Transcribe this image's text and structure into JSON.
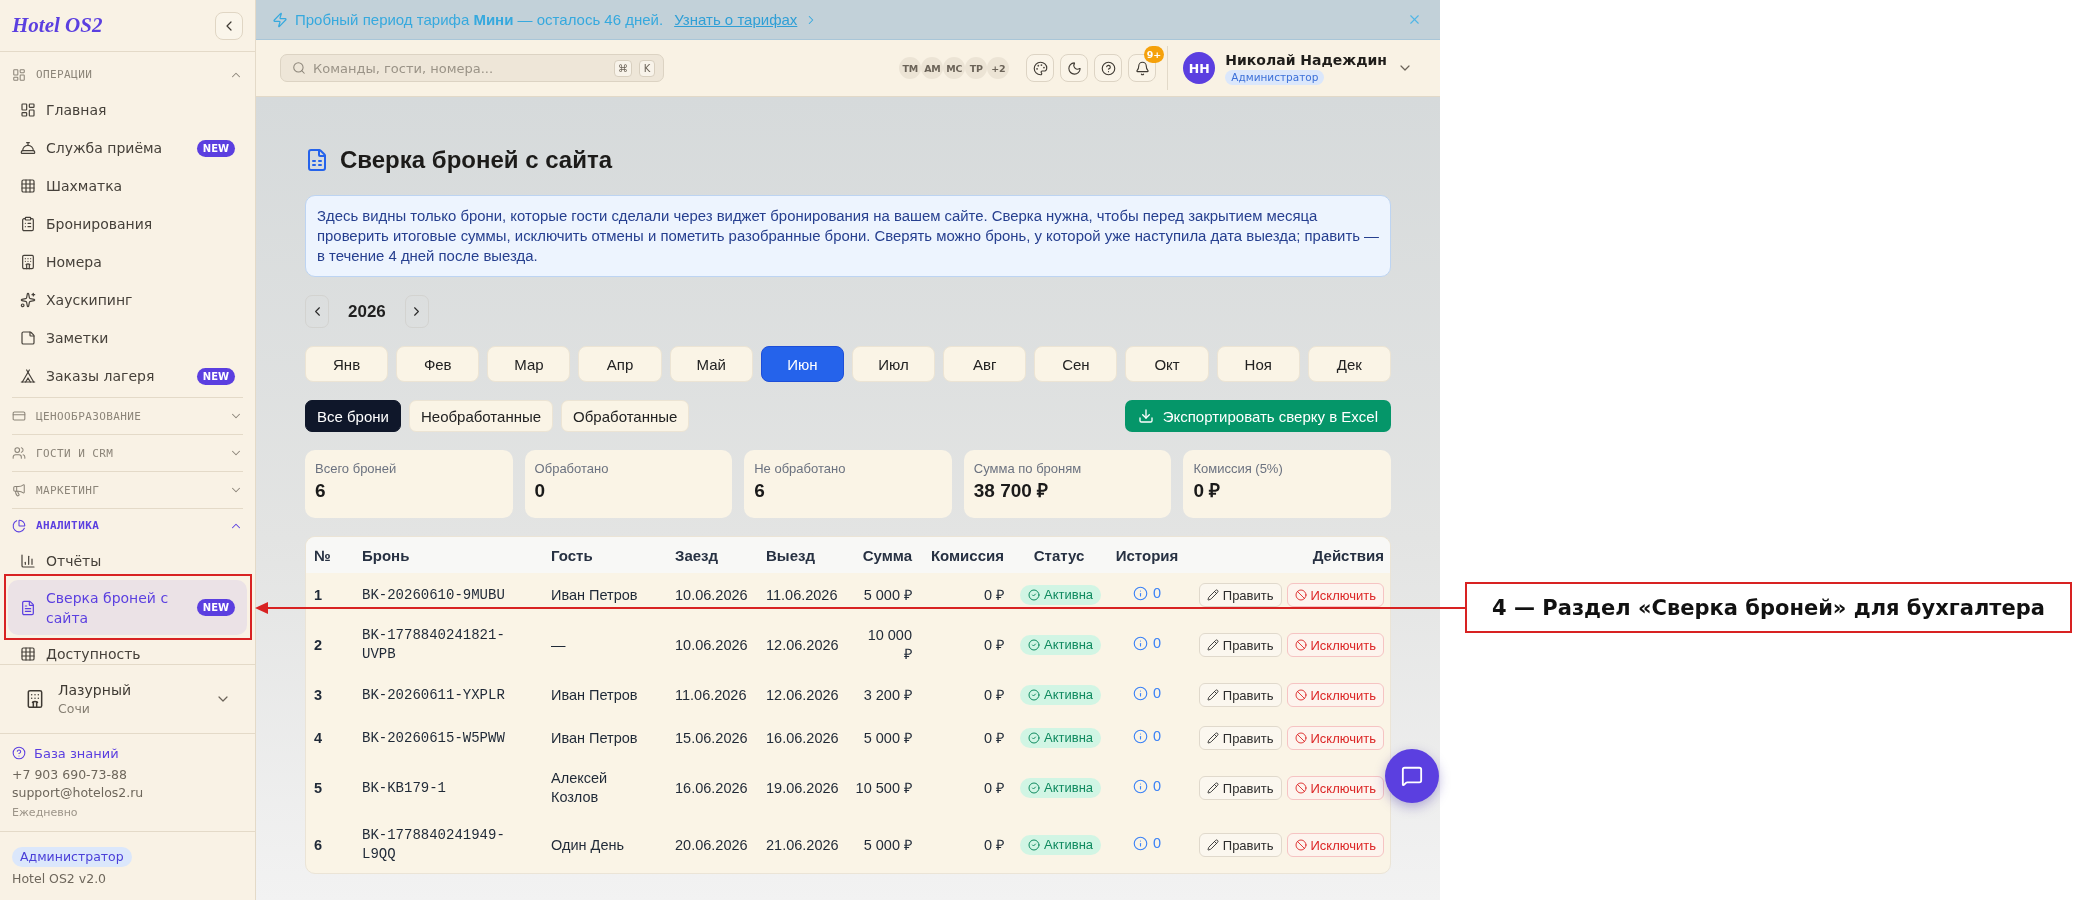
{
  "sidebar": {
    "logo": "Hotel OS2",
    "sections": [
      {
        "title": "ОПЕРАЦИИ",
        "expanded": true,
        "active": false,
        "items": [
          {
            "label": "Главная",
            "selected": false
          },
          {
            "label": "Служба приёма",
            "badge": "NEW",
            "selected": false
          },
          {
            "label": "Шахматка",
            "selected": false
          },
          {
            "label": "Бронирования",
            "selected": false
          },
          {
            "label": "Номера",
            "selected": false
          },
          {
            "label": "Хаускипинг",
            "selected": false
          },
          {
            "label": "Заметки",
            "selected": false
          },
          {
            "label": "Заказы лагеря",
            "badge": "NEW",
            "selected": false
          }
        ]
      },
      {
        "title": "ЦЕНООБРАЗОВАНИЕ",
        "expanded": false,
        "active": false
      },
      {
        "title": "ГОСТИ И CRM",
        "expanded": false,
        "active": false
      },
      {
        "title": "МАРКЕТИНГ",
        "expanded": false,
        "active": false
      },
      {
        "title": "АНАЛИТИКА",
        "expanded": true,
        "active": true,
        "items": [
          {
            "label": "Отчёты",
            "selected": false
          },
          {
            "label": "Сверка броней с сайта",
            "badge": "NEW",
            "selected": true
          },
          {
            "label": "Доступность",
            "selected": false
          }
        ]
      }
    ],
    "hotel": {
      "name": "Лазурный",
      "city": "Сочи"
    },
    "support": {
      "link": "База знаний",
      "phone": "+7 903 690-73-88",
      "email": "support@hotelos2.ru",
      "hours": "Ежедневно"
    },
    "role": "Администратор",
    "version": "Hotel OS2 v2.0"
  },
  "banner": {
    "text": "Пробный период тарифа **Мини** — осталось 46 дней.",
    "link": "Узнать о тарифах"
  },
  "header": {
    "search": {
      "placeholder": "Команды, гости, номера..."
    },
    "shortcut": [
      "⌘",
      "K"
    ],
    "online_users": [
      "ТМ",
      "АМ",
      "МС",
      "ТР"
    ],
    "online_more": "+2",
    "notifications": "9+",
    "user": {
      "initials": "НН",
      "name": "Николай Надеждин",
      "role": "Администратор"
    }
  },
  "page": {
    "title": "Сверка броней с сайта",
    "info": "Здесь видны только брони, которые гости сделали через виджет бронирования на вашем сайте. Сверка нужна, чтобы перед закрытием месяца проверить итоговые суммы, исключить отмены и пометить разобранные брони. Сверять можно бронь, у которой уже наступила дата выезда; править — в течение 4 дней после выезда.",
    "year": "2026",
    "months": [
      {
        "label": "Янв",
        "selected": false
      },
      {
        "label": "Фев",
        "selected": false
      },
      {
        "label": "Мар",
        "selected": false
      },
      {
        "label": "Апр",
        "selected": false
      },
      {
        "label": "Май",
        "selected": false
      },
      {
        "label": "Июн",
        "selected": true
      },
      {
        "label": "Июл",
        "selected": false
      },
      {
        "label": "Авг",
        "selected": false
      },
      {
        "label": "Сен",
        "selected": false
      },
      {
        "label": "Окт",
        "selected": false
      },
      {
        "label": "Ноя",
        "selected": false
      },
      {
        "label": "Дек",
        "selected": false
      }
    ],
    "filters": [
      {
        "label": "Все брони",
        "selected": true
      },
      {
        "label": "Необработанные",
        "selected": false
      },
      {
        "label": "Обработанные",
        "selected": false
      }
    ],
    "export": "Экспортировать сверку в Excel",
    "stats": [
      {
        "label": "Всего броней",
        "value": "6"
      },
      {
        "label": "Обработано",
        "value": "0"
      },
      {
        "label": "Не обработано",
        "value": "6"
      },
      {
        "label": "Сумма по броням",
        "value": "38 700 ₽"
      },
      {
        "label": "Комиссия (5%)",
        "value": "0 ₽"
      }
    ],
    "table": {
      "columns": [
        "№",
        "Бронь",
        "Гость",
        "Заезд",
        "Выезд",
        "Сумма",
        "Комиссия",
        "Статус",
        "История",
        "Действия"
      ],
      "rows": [
        {
          "number": "1",
          "booking": "BK-20260610-9MUBU",
          "guest": "Иван Петров",
          "check_in": "10.06.2026",
          "check_out": "11.06.2026",
          "amount": "5 000 ₽",
          "commission": "0 ₽",
          "status": "Активна",
          "history": "0",
          "edit": "Править",
          "exclude": "Исключить"
        },
        {
          "number": "2",
          "booking": "BK-1778840241821-UVPB",
          "guest": "—",
          "check_in": "10.06.2026",
          "check_out": "12.06.2026",
          "amount": "10 000\n₽",
          "commission": "0 ₽",
          "status": "Активна",
          "history": "0",
          "edit": "Править",
          "exclude": "Исключить"
        },
        {
          "number": "3",
          "booking": "BK-20260611-YXPLR",
          "guest": "Иван Петров",
          "check_in": "11.06.2026",
          "check_out": "12.06.2026",
          "amount": "3 200 ₽",
          "commission": "0 ₽",
          "status": "Активна",
          "history": "0",
          "edit": "Править",
          "exclude": "Исключить"
        },
        {
          "number": "4",
          "booking": "BK-20260615-W5PWW",
          "guest": "Иван Петров",
          "check_in": "15.06.2026",
          "check_out": "16.06.2026",
          "amount": "5 000 ₽",
          "commission": "0 ₽",
          "status": "Активна",
          "history": "0",
          "edit": "Править",
          "exclude": "Исключить"
        },
        {
          "number": "5",
          "booking": "BK-KB179-1",
          "guest": "Алексей Козлов",
          "check_in": "16.06.2026",
          "check_out": "19.06.2026",
          "amount": "10 500 ₽",
          "commission": "0 ₽",
          "status": "Активна",
          "history": "0",
          "edit": "Править",
          "exclude": "Исключить"
        },
        {
          "number": "6",
          "booking": "BK-1778840241949-L9QQ",
          "guest": "Один День",
          "check_in": "20.06.2026",
          "check_out": "21.06.2026",
          "amount": "5 000 ₽",
          "commission": "0 ₽",
          "status": "Активна",
          "history": "0",
          "edit": "Править",
          "exclude": "Исключить"
        }
      ]
    }
  },
  "annotation": {
    "label": "4 — Раздел «Сверка броней» для бухгалтера"
  }
}
